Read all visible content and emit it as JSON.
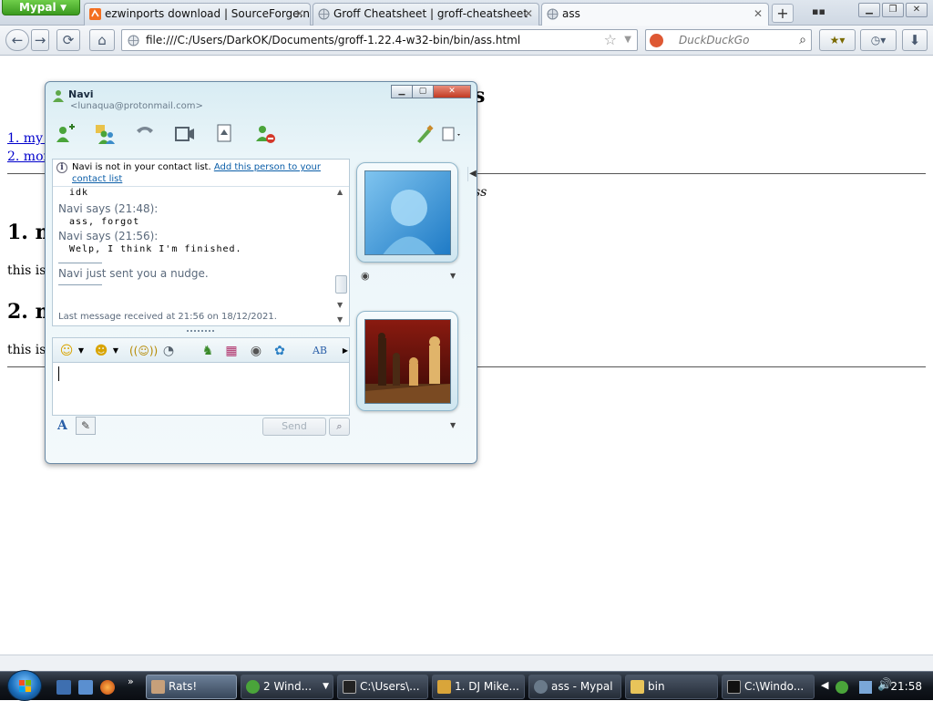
{
  "browser": {
    "app_menu_label": "Mypal",
    "tabs": [
      {
        "title": "ezwinports download | SourceForge.n...",
        "active": false
      },
      {
        "title": "Groff Cheatsheet | groff-cheatsheet",
        "active": false
      },
      {
        "title": "ass",
        "active": true
      }
    ],
    "url": "file:///C:/Users/DarkOK/Documents/groff-1.22.4-w32-bin/bin/ass.html",
    "search_placeholder": "DuckDuckGo"
  },
  "page": {
    "title_fragment": "s",
    "toc": [
      "1. my s",
      "2. mor"
    ],
    "italic_fragment": "ss",
    "sections": [
      {
        "heading": "1. m",
        "text": "this is a"
      },
      {
        "heading": "2. m",
        "text": "this is a"
      }
    ]
  },
  "messenger": {
    "contact_name": "Navi",
    "contact_email": "<lunaqua@protonmail.com>",
    "notice_text": "Navi is not in your contact list. ",
    "notice_link": "Add this person to your contact list",
    "messages": [
      {
        "sender": "",
        "body": "idk"
      },
      {
        "sender": "Navi says (21:48):",
        "body": "ass, forgot"
      },
      {
        "sender": "Navi says (21:56):",
        "body": "Welp, I think I'm finished."
      }
    ],
    "nudge_text": "Navi just sent you a nudge.",
    "last_received": "Last message received at 21:56 on 18/12/2021.",
    "send_label": "Send",
    "toolbar_icons": [
      "add-contact-icon",
      "invite-icon",
      "call-icon",
      "video-icon",
      "share-icon",
      "block-icon",
      "paint-icon",
      "menu-icon"
    ],
    "format_icons": [
      "emoticon-icon",
      "wink-icon",
      "nudge-icon",
      "voice-clip-icon",
      "games-icon",
      "backgrounds-icon",
      "activities-icon",
      "share-folder-icon",
      "font-icon"
    ]
  },
  "taskbar": {
    "tasks": [
      {
        "label": "Rats!",
        "active": true
      },
      {
        "label": "2 Wind...",
        "active": false
      },
      {
        "label": "C:\\Users\\...",
        "active": false
      },
      {
        "label": "1. DJ Mike...",
        "active": false
      },
      {
        "label": "ass - Mypal",
        "active": false
      },
      {
        "label": "bin",
        "active": false
      },
      {
        "label": "C:\\Windo...",
        "active": false
      }
    ],
    "clock": "21:58",
    "accent_color": "#1b6fbd"
  }
}
